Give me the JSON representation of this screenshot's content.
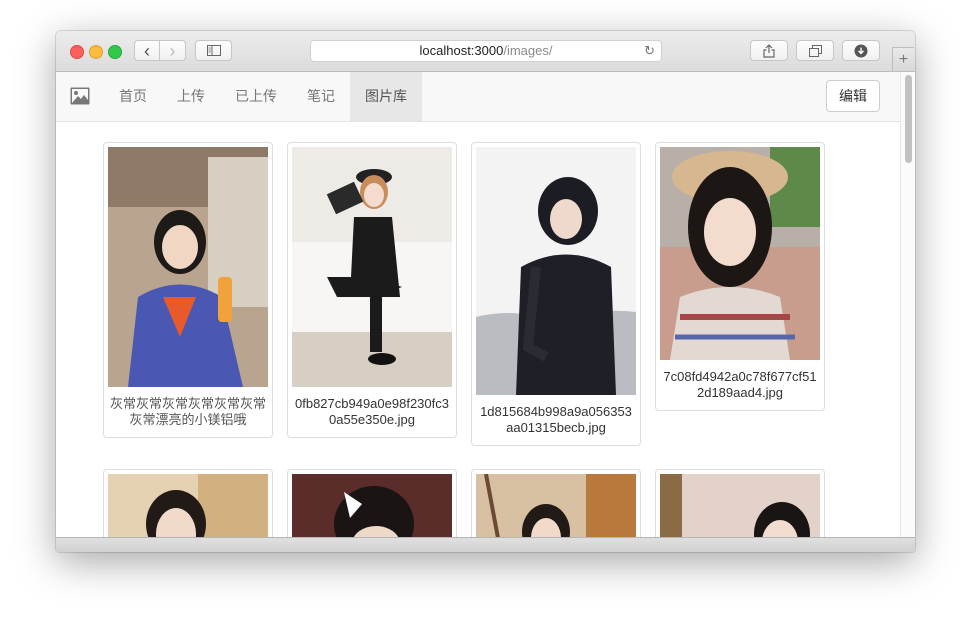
{
  "browser": {
    "address_host": "localhost:3000",
    "address_path": "/images/",
    "back_glyph": "‹",
    "forward_glyph": "›",
    "reload_glyph": "↻",
    "new_tab_glyph": "+",
    "traffic_colors": {
      "close": "#fc605c",
      "minimize": "#fdbc40",
      "maximize": "#34c84a"
    }
  },
  "navbar": {
    "brand_icon": "image-icon",
    "items": [
      {
        "label": "首页",
        "active": false
      },
      {
        "label": "上传",
        "active": false
      },
      {
        "label": "已上传",
        "active": false
      },
      {
        "label": "笔记",
        "active": false
      },
      {
        "label": "图片库",
        "active": true
      }
    ],
    "edit_label": "编辑"
  },
  "gallery": {
    "rows": [
      {
        "items": [
          {
            "caption": "灰常灰常灰常灰常灰常灰常灰常漂亮的小镁铝哦",
            "tone": "#b9a48f"
          },
          {
            "caption": "0fb827cb949a0e98f230fc30a55e350e.jpg",
            "tone": "#e9e6e2"
          },
          {
            "caption": "1d815684b998a9a056353aa01315becb.jpg",
            "tone": "#f2f2f2"
          },
          {
            "caption": "7c08fd4942a0c78f677cf512d189aad4.jpg",
            "tone": "#c7b3a5"
          }
        ]
      },
      {
        "items": [
          {
            "caption": "",
            "tone": "#d8c3a2"
          },
          {
            "caption": "",
            "tone": "#6b3a35"
          },
          {
            "caption": "",
            "tone": "#c9a98a"
          },
          {
            "caption": "",
            "tone": "#d6c2b8"
          }
        ]
      }
    ]
  }
}
